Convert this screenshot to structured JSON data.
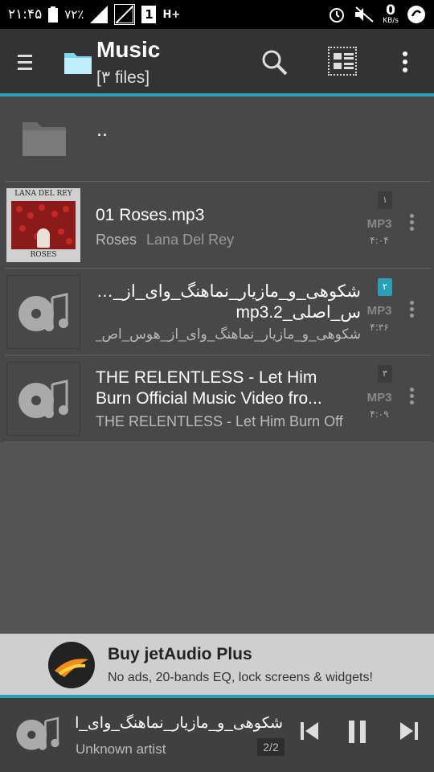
{
  "status_bar": {
    "time": "۲۱:۴۵",
    "battery": "۷۲٪",
    "signal_label": "H+",
    "sim_label": "1",
    "net_speed_value": "0",
    "net_speed_unit": "KB/s"
  },
  "header": {
    "title": "Music",
    "subtitle": "[۳ files]"
  },
  "list": {
    "parent_label": "..",
    "items": [
      {
        "index": "۱",
        "title": "01 Roses.mp3",
        "album": "Roses",
        "artist": "Lana Del Rey",
        "format": "MP3",
        "duration": "۴:۰۴",
        "art_top": "LANA DEL REY",
        "art_bottom": "ROSES",
        "active": false
      },
      {
        "index": "۲",
        "title_line1": "شکوهی_و_مازیار_نماهنگ_وای_از_هو_",
        "title_line2": "س_اصلی_mp3.2",
        "subtitle": "شکوهی_و_مازیار_نماهنگ_وای_از_هوس_اص_",
        "format": "MP3",
        "duration": "۴:۳۶",
        "active": true
      },
      {
        "index": "۳",
        "title_line1": "THE RELENTLESS - Let Him",
        "title_line2": "Burn Official Music Video fro...",
        "subtitle": "THE RELENTLESS - Let Him Burn Off",
        "format": "MP3",
        "duration": "۴:۰۹",
        "active": false
      }
    ]
  },
  "ad": {
    "title": "Buy jetAudio Plus",
    "subtitle": "No ads, 20-bands EQ, lock screens & widgets!"
  },
  "player": {
    "title": "شکوهی_و_مازیار_نماهنگ_وای_از_",
    "artist": "Unknown artist",
    "queue": "2/2"
  },
  "colors": {
    "accent": "#2a9fb5",
    "appbar": "#333333",
    "list_bg": "#484848"
  }
}
